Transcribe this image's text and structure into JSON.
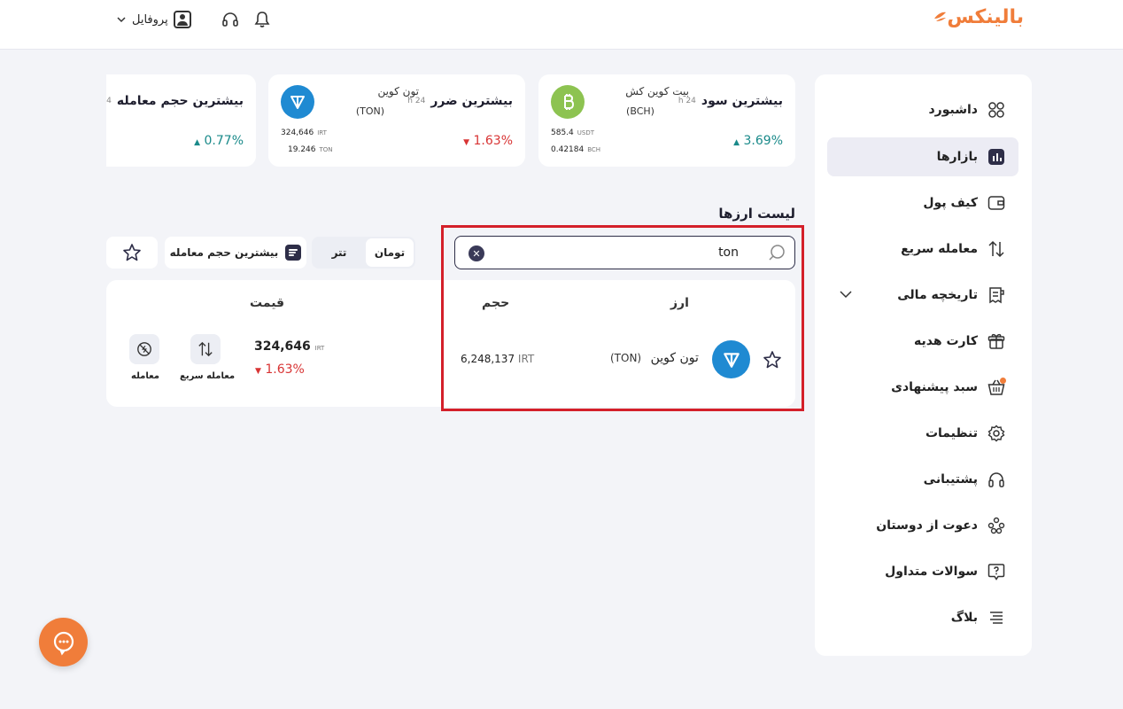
{
  "header": {
    "logo_text": "بالینکس",
    "profile_label": "پروفایل",
    "icons": [
      "bell-icon",
      "headset-icon",
      "user-icon",
      "chevron-down-icon"
    ]
  },
  "colors": {
    "brand": "#f07d3a",
    "active_nav": "#ececf4",
    "up": "#1a8a8a",
    "down": "#d83434",
    "highlight": "#d4202a"
  },
  "sidebar": {
    "items": [
      {
        "label": "داشبورد",
        "icon": "grid-icon"
      },
      {
        "label": "بازارها",
        "icon": "markets-icon",
        "active": true
      },
      {
        "label": "کیف پول",
        "icon": "wallet-icon"
      },
      {
        "label": "معامله سریع",
        "icon": "swap-icon"
      },
      {
        "label": "تاریخچه مالی",
        "icon": "receipt-icon"
      },
      {
        "label": "کارت هدیه",
        "icon": "gift-icon"
      },
      {
        "label": "سبد پیشنهادی",
        "icon": "basket-icon"
      },
      {
        "label": "تنظیمات",
        "icon": "gear-icon"
      },
      {
        "label": "پشتیبانی",
        "icon": "headset-icon"
      },
      {
        "label": "دعوت از دوستان",
        "icon": "people-icon"
      },
      {
        "label": "سوالات متداول",
        "icon": "question-icon"
      },
      {
        "label": "بلاگ",
        "icon": "blog-icon"
      }
    ]
  },
  "stats": {
    "period": "24 h",
    "top_gain": {
      "title": "بیشترین سود",
      "change": "3.69%",
      "coin_name": "بیت کوین کش",
      "coin_symbol": "(BCH)",
      "price_usdt": "585.4",
      "price_usdt_unit": "USDT",
      "amount": "0.42184",
      "amount_unit": "BCH"
    },
    "top_loss": {
      "title": "بیشترین ضرر",
      "change": "1.63%",
      "coin_name": "تون کوین",
      "coin_symbol": "(TON)",
      "price_irt": "324,646",
      "price_irt_unit": "IRT",
      "amount": "19.246",
      "amount_unit": "TON"
    },
    "top_volume": {
      "title": "بیشترین حجم معامله",
      "change": "0.77%"
    }
  },
  "market": {
    "section_title": "لیست ارزها",
    "search": {
      "value": "ton",
      "placeholder": ""
    },
    "tabs": [
      "تومان",
      "تتر"
    ],
    "active_tab": "تومان",
    "sort_label": "بیشترین حجم معامله",
    "columns": {
      "coin": "ارز",
      "volume": "حجم",
      "price": "قیمت"
    },
    "rows": [
      {
        "coin_name": "تون کوین",
        "coin_symbol": "(TON)",
        "volume": "6,248,137",
        "volume_unit": "IRT",
        "price": "324,646",
        "price_unit": "IRT",
        "change": "1.63%",
        "change_direction": "down",
        "actions": [
          "معامله سریع",
          "معامله"
        ]
      }
    ]
  }
}
